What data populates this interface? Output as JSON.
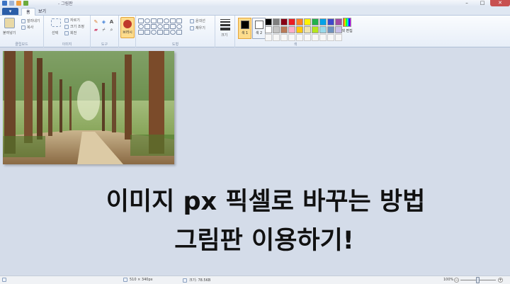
{
  "window": {
    "title": "- 그림판",
    "controls": {
      "minimize": "–",
      "maximize": "□",
      "close": "✕"
    }
  },
  "tabs": {
    "file": "▾",
    "home": "홈",
    "view": "보기"
  },
  "ribbon": {
    "clipboard": {
      "paste": "붙여넣기",
      "cut": "잘라내기",
      "copy": "복사",
      "label": "클립보드"
    },
    "image": {
      "select": "선택",
      "crop": "자르기",
      "resize": "크기 조정",
      "rotate": "회전",
      "label": "이미지"
    },
    "tools": {
      "label": "도구"
    },
    "brushes": {
      "label": "브러시"
    },
    "shapes": {
      "outline": "윤곽선",
      "fill": "채우기",
      "label": "도형"
    },
    "size": {
      "label": "크기"
    },
    "colors": {
      "color1": "색 1",
      "color2": "색 2",
      "edit": "색 편집",
      "label": "색",
      "palette": [
        "#000000",
        "#7f7f7f",
        "#880015",
        "#ed1c24",
        "#ff7f27",
        "#fff200",
        "#22b14c",
        "#00a2e8",
        "#3f48cc",
        "#a349a4",
        "#ffffff",
        "#c3c3c3",
        "#b97a57",
        "#ffaec9",
        "#ffc90e",
        "#efe4b0",
        "#b5e61d",
        "#99d9ea",
        "#7092be",
        "#c8bfe7"
      ],
      "color1_value": "#000000",
      "color2_value": "#ffffff"
    }
  },
  "caption": {
    "line1": "이미지 px 픽셀로 바꾸는 방법",
    "line2": "그림판 이용하기!"
  },
  "status": {
    "dimensions": "510 × 340px",
    "file_size": "크기: 78.5KB",
    "zoom": "100%"
  }
}
